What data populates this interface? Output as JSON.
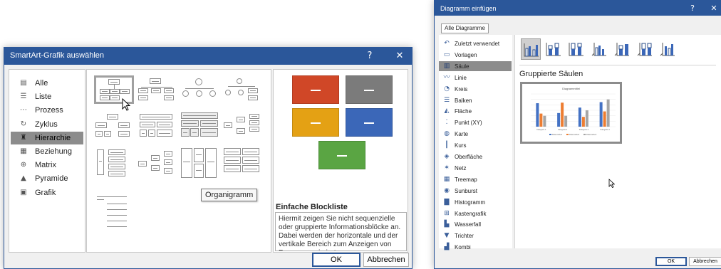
{
  "smartart": {
    "title": "SmartArt-Grafik auswählen",
    "help_label": "?",
    "close_label": "✕",
    "categories": [
      {
        "label": "Alle",
        "icon": "all-icon"
      },
      {
        "label": "Liste",
        "icon": "list-icon"
      },
      {
        "label": "Prozess",
        "icon": "process-icon"
      },
      {
        "label": "Zyklus",
        "icon": "cycle-icon"
      },
      {
        "label": "Hierarchie",
        "icon": "hierarchy-icon"
      },
      {
        "label": "Beziehung",
        "icon": "relationship-icon"
      },
      {
        "label": "Matrix",
        "icon": "matrix-icon"
      },
      {
        "label": "Pyramide",
        "icon": "pyramid-icon"
      },
      {
        "label": "Grafik",
        "icon": "picture-icon"
      }
    ],
    "selected_category": "Hierarchie",
    "tooltip": "Organigramm",
    "preview_colors": [
      "#d04727",
      "#7b7b7b",
      "#e4a114",
      "#3b67b8",
      "#5aa543"
    ],
    "description_title": "Einfache Blockliste",
    "description": "Hiermit zeigen Sie nicht sequenzielle oder gruppierte Informationsblöcke an. Dabei werden der horizontale und der vertikale Bereich zum Anzeigen von Formen maximiert.",
    "ok_label": "OK",
    "cancel_label": "Abbrechen"
  },
  "chart": {
    "title": "Diagramm einfügen",
    "help_label": "?",
    "close_label": "✕",
    "tab_label": "Alle Diagramme",
    "types": [
      {
        "label": "Zuletzt verwendet",
        "icon": "recent-icon"
      },
      {
        "label": "Vorlagen",
        "icon": "templates-icon"
      },
      {
        "label": "Säule",
        "icon": "column-chart-icon"
      },
      {
        "label": "Linie",
        "icon": "line-chart-icon"
      },
      {
        "label": "Kreis",
        "icon": "pie-chart-icon"
      },
      {
        "label": "Balken",
        "icon": "bar-chart-icon"
      },
      {
        "label": "Fläche",
        "icon": "area-chart-icon"
      },
      {
        "label": "Punkt (XY)",
        "icon": "scatter-chart-icon"
      },
      {
        "label": "Karte",
        "icon": "map-chart-icon"
      },
      {
        "label": "Kurs",
        "icon": "stock-chart-icon"
      },
      {
        "label": "Oberfläche",
        "icon": "surface-chart-icon"
      },
      {
        "label": "Netz",
        "icon": "radar-chart-icon"
      },
      {
        "label": "Treemap",
        "icon": "treemap-icon"
      },
      {
        "label": "Sunburst",
        "icon": "sunburst-icon"
      },
      {
        "label": "Histogramm",
        "icon": "histogram-icon"
      },
      {
        "label": "Kastengrafik",
        "icon": "box-whisker-icon"
      },
      {
        "label": "Wasserfall",
        "icon": "waterfall-icon"
      },
      {
        "label": "Trichter",
        "icon": "funnel-icon"
      },
      {
        "label": "Kombi",
        "icon": "combo-chart-icon"
      }
    ],
    "selected_type": "Säule",
    "subtype_title": "Gruppierte Säulen",
    "ok_label": "OK",
    "cancel_label": "Abbrechen",
    "series_colors": [
      "#4472c4",
      "#ed7d31",
      "#a5a5a5"
    ]
  },
  "chart_data": {
    "type": "bar",
    "title": "Diagrammtitel",
    "categories": [
      "Kategorie 1",
      "Kategorie 2",
      "Kategorie 3",
      "Kategorie 4"
    ],
    "series": [
      {
        "name": "Datenreihe1",
        "values": [
          4.3,
          2.5,
          3.5,
          4.5
        ]
      },
      {
        "name": "Datenreihe2",
        "values": [
          2.4,
          4.4,
          1.8,
          2.8
        ]
      },
      {
        "name": "Datenreihe3",
        "values": [
          2,
          2,
          3,
          5
        ]
      }
    ],
    "ylim": [
      0,
      6
    ],
    "grid": true,
    "legend": "bottom"
  }
}
